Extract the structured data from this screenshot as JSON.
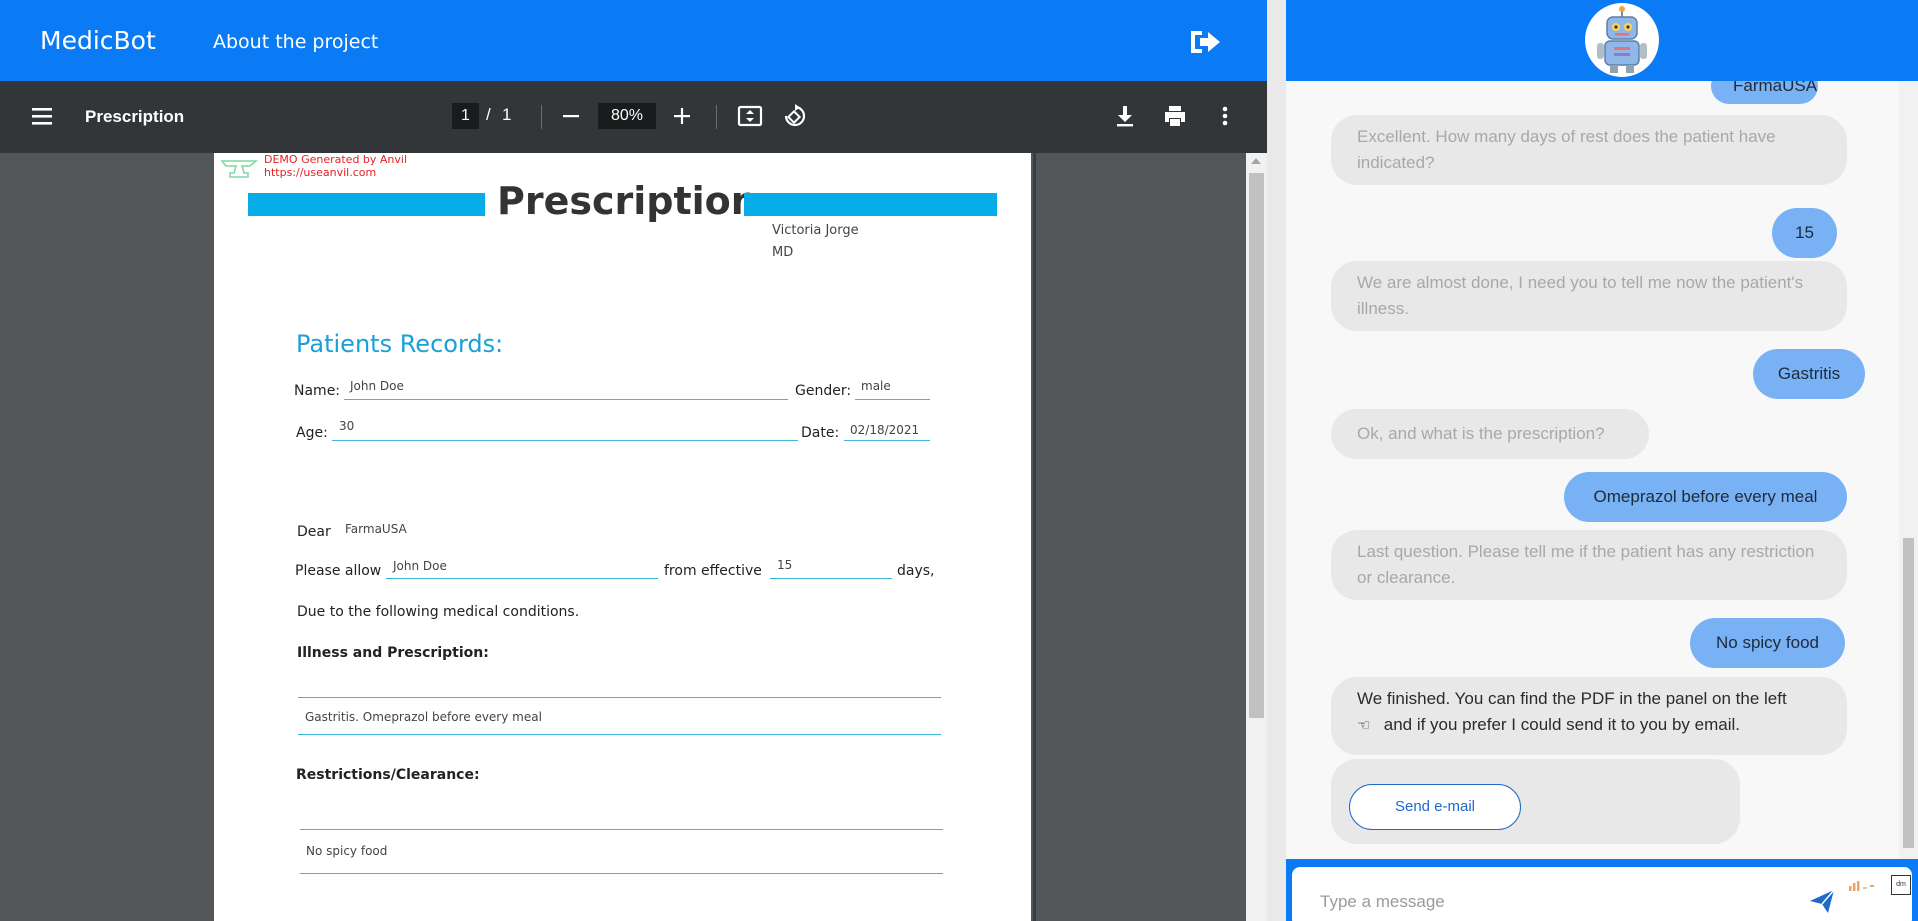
{
  "nav": {
    "brand": "MedicBot",
    "about": "About the project",
    "logout_icon": "logout-icon"
  },
  "pdf_toolbar": {
    "menu_icon": "hamburger-menu-icon",
    "title": "Prescription",
    "page_current": "1",
    "page_separator": "/",
    "page_total": "1",
    "zoom": "80%",
    "icons": [
      "zoom-out-icon",
      "zoom-in-icon",
      "fit-page-icon",
      "rotate-icon",
      "download-icon",
      "print-icon",
      "more-options-icon"
    ]
  },
  "document": {
    "watermark_line1": "DEMO Generated by Anvil",
    "watermark_line2": "https://useanvil.com",
    "title": "Prescription",
    "doctor_name": "Victoria Jorge",
    "doctor_degree": "MD",
    "records_heading": "Patients Records:",
    "name_label": "Name:",
    "name_value": "John Doe",
    "gender_label": "Gender:",
    "gender_value": "male",
    "age_label": "Age:",
    "age_value": "30",
    "date_label": "Date:",
    "date_value": "02/18/2021",
    "dear_label": "Dear",
    "dear_value": "FarmaUSA",
    "allow_label": "Please allow",
    "allow_value": "John Doe",
    "effective_label": "from effective",
    "effective_value": "15",
    "days_label": "days,",
    "conditions_text": "Due to the following medical conditions.",
    "illness_heading": "Illness and Prescription:",
    "illness_value": "Gastritis. Omeprazol before every meal",
    "restrictions_heading": "Restrictions/Clearance:",
    "restrictions_value": "No spicy food",
    "accent_color": "#06ace6",
    "watermark_color": "#e52126"
  },
  "chat": {
    "avatar_icon": "robot-avatar-icon",
    "messages": [
      {
        "from": "user",
        "text": "FarmaUSA"
      },
      {
        "from": "bot",
        "text": "Excellent. How many days of rest does the patient have indicated?"
      },
      {
        "from": "user",
        "text": "15"
      },
      {
        "from": "bot",
        "text": "We are almost done, I need you to tell me now the patient's illness."
      },
      {
        "from": "user",
        "text": "Gastritis"
      },
      {
        "from": "bot",
        "text": "Ok, and what is the prescription?"
      },
      {
        "from": "user",
        "text": "Omeprazol before every meal"
      },
      {
        "from": "bot",
        "text": "Last question. Please tell me if the patient has any restriction or clearance."
      },
      {
        "from": "user",
        "text": "No spicy food"
      },
      {
        "from": "bot",
        "text": "We finished. You can find the PDF in the panel on the left",
        "text2": "and if you prefer I could send it to you by email.",
        "icon": "pointing-left-hand-icon"
      }
    ],
    "send_email_label": "Send e-mail",
    "composer_placeholder": "Type a message",
    "send_icon": "send-icon",
    "user_bubble_color": "#78b2f5",
    "bot_bubble_color": "#e8e8e8",
    "header_color": "#0a7bf5"
  }
}
